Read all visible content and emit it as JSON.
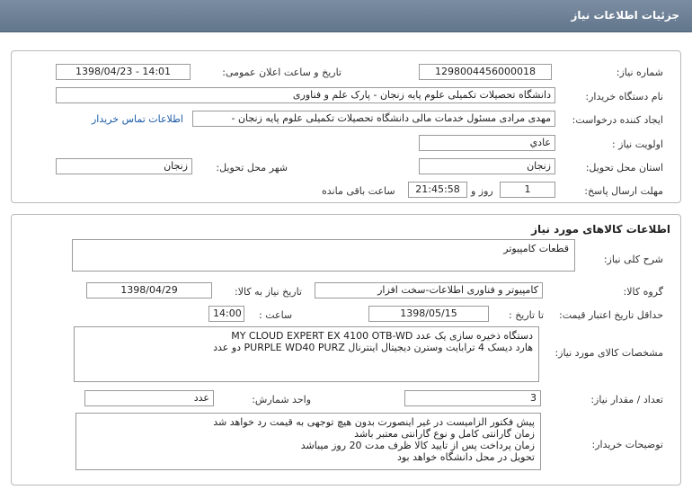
{
  "header": {
    "title": "جزئیات اطلاعات نیاز"
  },
  "info": {
    "need_number_label": "شماره نیاز:",
    "need_number": "1298004456000018",
    "announce_label": "تاریخ و ساعت اعلان عمومی:",
    "announce_value": "1398/04/23 - 14:01",
    "buyer_label": "نام دستگاه خریدار:",
    "buyer": "دانشگاه تحصیلات تکمیلی علوم پایه زنجان - پارک علم و فناوری",
    "creator_label": "ایجاد کننده درخواست:",
    "creator": "مهدی مرادی مسئول خدمات مالی دانشگاه تحصیلات تکمیلی علوم پایه زنجان -",
    "contact_link": "اطلاعات تماس خریدار",
    "priority_label": "اولویت نیاز :",
    "priority": "عادي",
    "province_label": "استان محل تحویل:",
    "province": "زنجان",
    "city_label": "شهر محل تحویل:",
    "city": "زنجان",
    "deadline_label": "مهلت ارسال پاسخ:",
    "deadline_days": "1",
    "days_and": "روز و",
    "deadline_time": "21:45:58",
    "remaining": "ساعت باقی مانده"
  },
  "goods": {
    "section_title": "اطلاعات کالاهای مورد نیاز",
    "general_desc_label": "شرح کلی نیاز:",
    "general_desc": "قطعات کامپیوتر",
    "group_label": "گروه کالا:",
    "group": "کامپیوتر و فناوری اطلاعات-سخت افزار",
    "need_date_label": "تاریخ نیاز به کالا:",
    "need_date": "1398/04/29",
    "validity_label": "حداقل تاریخ اعتبار قیمت:",
    "until_date_label": "تا تاریخ :",
    "until_date": "1398/05/15",
    "hour_label": "ساعت :",
    "hour": "14:00",
    "specs_label": "مشخصات کالای مورد نیاز:",
    "specs_lines": [
      "MY CLOUD EXPERT EX 4100 OTB-WD  دستگاه ذخیره سازی  یک عدد",
      "هارد دیسک 4 ترابایت وسترن دیجیتال اینترنال PURPLE WD40 PURZ  دو عدد"
    ],
    "qty_label": "تعداد / مقدار نیاز:",
    "qty": "3",
    "unit_label": "واحد شمارش:",
    "unit": "عدد",
    "buyer_notes_label": "توضیحات خریدار:",
    "buyer_notes_lines": [
      "پیش فکتور الزامیست در غیر اینصورت بدون هیچ توجهی به قیمت رد خواهد شد",
      "زمان گارانتی کامل و نوع گارانتی معتبر باشد",
      "زمان پرداخت پس از تایید کالا ظرف مدت 20 روز میباشد",
      "تحویل در محل دانشگاه خواهد بود"
    ]
  }
}
